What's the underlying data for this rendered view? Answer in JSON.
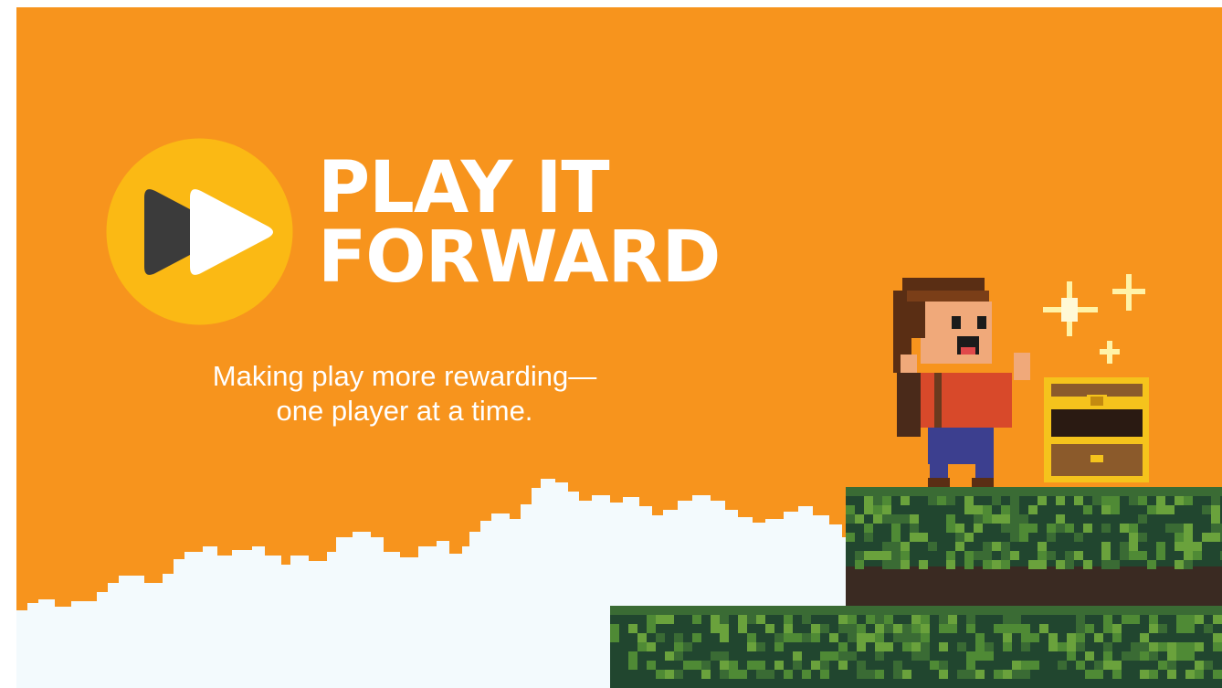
{
  "colors": {
    "background": "#f7941d",
    "logo_circle": "#fbb914",
    "logo_arrow_dark": "#3b3b3b",
    "logo_arrow_light": "#ffffff",
    "title_text": "#ffffff",
    "cloud": "#f3fafd",
    "grass_dark": "#21462f",
    "grass_mid": "#3a6b34",
    "grass_light": "#6aa23c",
    "dirt": "#3a2a22",
    "chest_gold": "#f5c31c",
    "chest_wood": "#8b5a2b"
  },
  "logo": {
    "icon": "fast-forward-icon"
  },
  "title": {
    "line1": "PLAY IT",
    "line2": "FORWARD"
  },
  "tagline": {
    "line1": "Making play more rewarding—",
    "line2": "one player at a time."
  },
  "scene": {
    "character": "pixel-hero-cheering",
    "treasure": "treasure-chest-icon",
    "sparkles": "sparkle-icon"
  }
}
